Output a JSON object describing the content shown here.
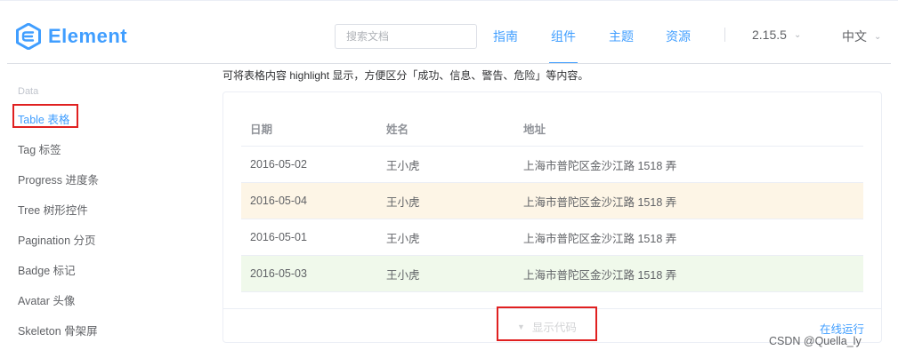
{
  "header": {
    "logo_text": "Element",
    "search_placeholder": "搜索文档",
    "nav": [
      "指南",
      "组件",
      "主题",
      "资源"
    ],
    "version": "2.15.5",
    "language": "中文"
  },
  "sidebar": {
    "group": "Data",
    "items": [
      {
        "label": "Table 表格"
      },
      {
        "label": "Tag 标签"
      },
      {
        "label": "Progress 进度条"
      },
      {
        "label": "Tree 树形控件"
      },
      {
        "label": "Pagination 分页"
      },
      {
        "label": "Badge 标记"
      },
      {
        "label": "Avatar 头像"
      },
      {
        "label": "Skeleton 骨架屏"
      }
    ]
  },
  "main": {
    "description": "可将表格内容 highlight 显示，方便区分「成功、信息、警告、危险」等内容。",
    "table": {
      "headers": [
        "日期",
        "姓名",
        "地址"
      ],
      "rows": [
        [
          "2016-05-02",
          "王小虎",
          "上海市普陀区金沙江路 1518 弄"
        ],
        [
          "2016-05-04",
          "王小虎",
          "上海市普陀区金沙江路 1518 弄"
        ],
        [
          "2016-05-01",
          "王小虎",
          "上海市普陀区金沙江路 1518 弄"
        ],
        [
          "2016-05-03",
          "王小虎",
          "上海市普陀区金沙江路 1518 弄"
        ]
      ]
    },
    "show_code": "显示代码",
    "run_online": "在线运行"
  },
  "watermark": "CSDN @Quella_ly",
  "colors": {
    "accent": "#409eff",
    "warning_row": "#fdf5e6",
    "success_row": "#f0f9eb",
    "highlight_box": "#e02020"
  },
  "icons": {
    "logo": "element-logo-icon",
    "chevron": "chevron-down-icon",
    "show_code": "caret-down-icon"
  }
}
